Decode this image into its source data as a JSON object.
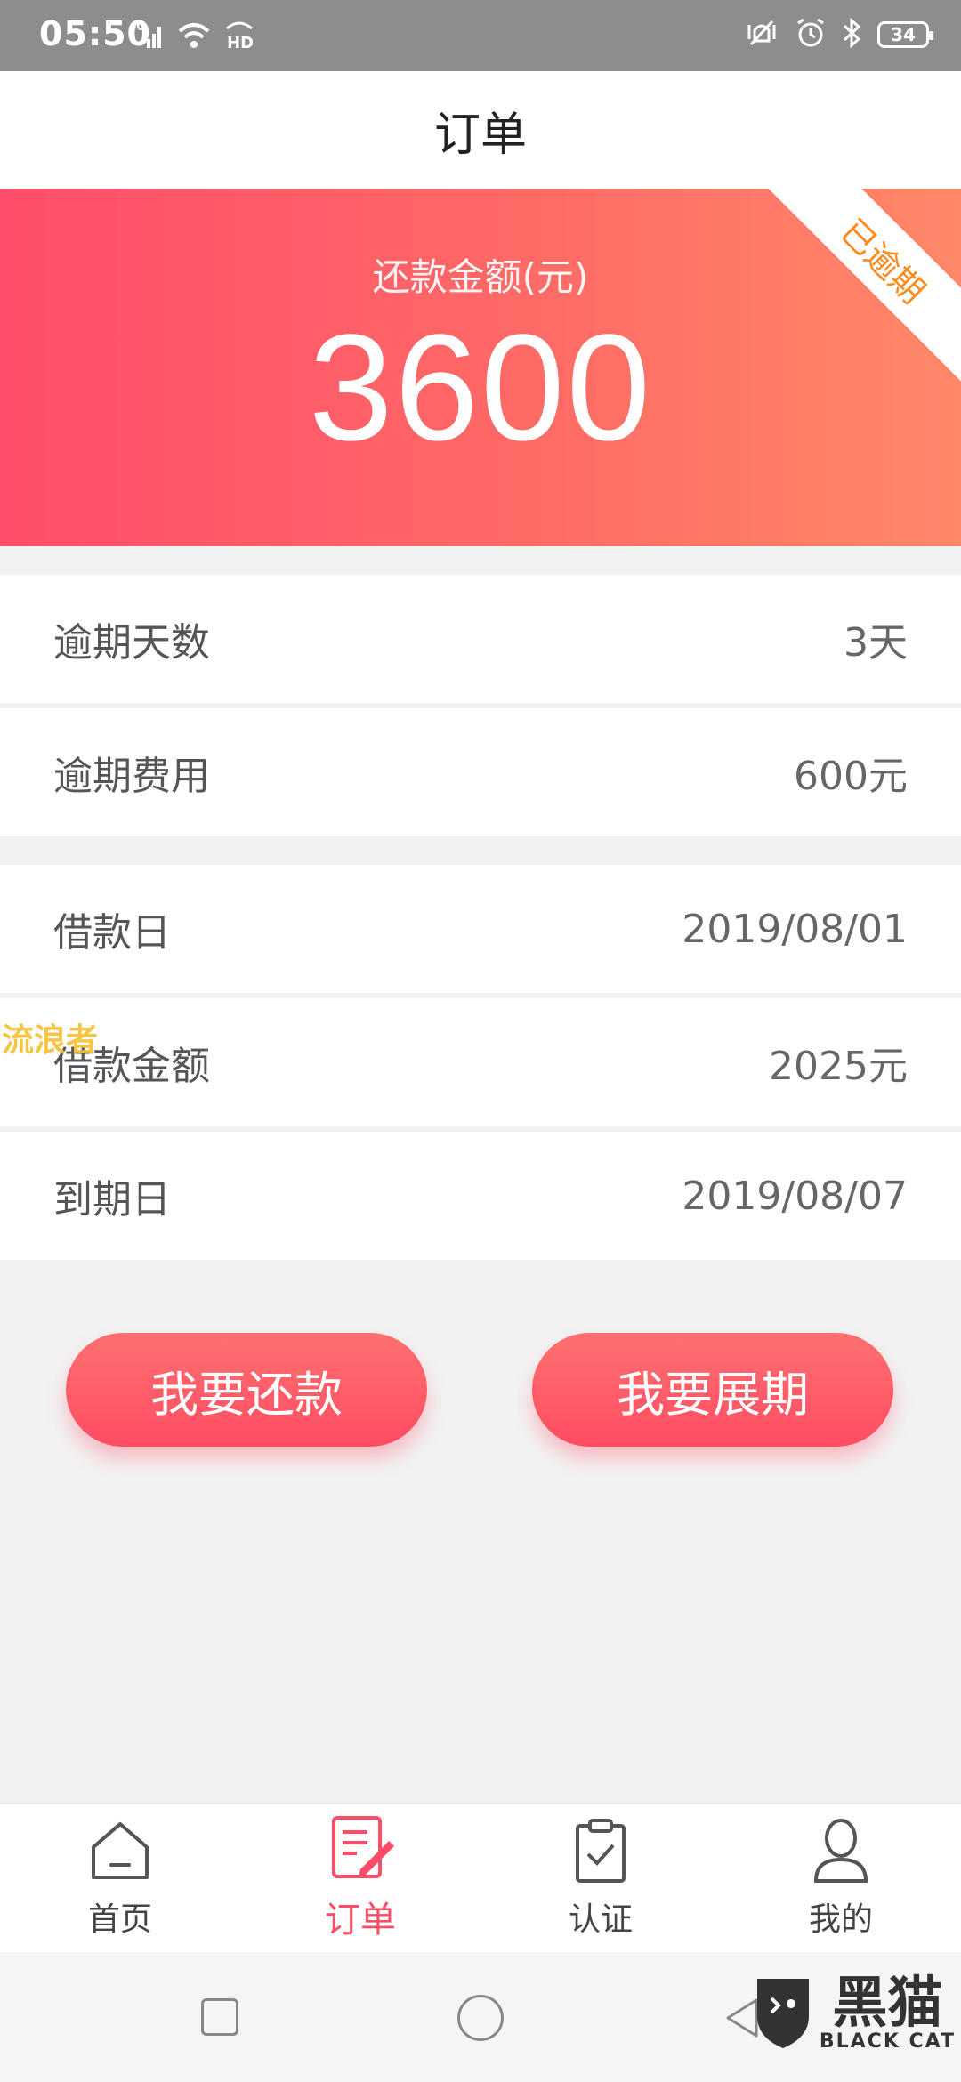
{
  "status_bar": {
    "time": "05:50",
    "network": "4G",
    "hd": "HD",
    "battery": "34"
  },
  "header": {
    "title": "订单"
  },
  "hero": {
    "label": "还款金额(元)",
    "amount": "3600",
    "ribbon": "已逾期"
  },
  "details": [
    {
      "label": "逾期天数",
      "value": "3天"
    },
    {
      "label": "逾期费用",
      "value": "600元"
    },
    {
      "label": "借款日",
      "value": "2019/08/01"
    },
    {
      "label": "借款金额",
      "value": "2025元"
    },
    {
      "label": "到期日",
      "value": "2019/08/07"
    }
  ],
  "watermark": "流浪者",
  "actions": {
    "repay": "我要还款",
    "extend": "我要展期"
  },
  "bottom_nav": [
    {
      "label": "首页",
      "icon": "home-icon",
      "active": false
    },
    {
      "label": "订单",
      "icon": "order-edit-icon",
      "active": true
    },
    {
      "label": "认证",
      "icon": "clipboard-check-icon",
      "active": false
    },
    {
      "label": "我的",
      "icon": "user-icon",
      "active": false
    }
  ],
  "logo": {
    "cn": "黑猫",
    "en": "BLACK CAT"
  },
  "colors": {
    "accent": "#ff4c68",
    "ribbon_text": "#ff8a1c"
  }
}
